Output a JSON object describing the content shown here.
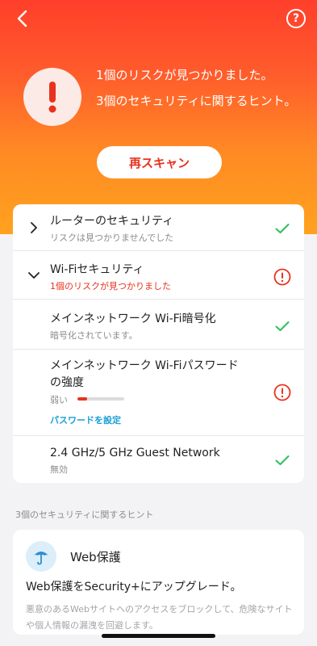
{
  "header": {
    "back_icon": "chevron-left-icon",
    "help_icon": "question-circle-icon",
    "alert_icon": "exclamation-icon",
    "message_line1": "1個のリスクが見つかりました。",
    "message_line2": "3個のセキュリティに関するヒント。",
    "rescan_label": "再スキャン"
  },
  "checks": [
    {
      "title": "ルーターのセキュリティ",
      "subtitle": "リスクは見つかりませんでした",
      "expand_icon": "chevron-right-icon",
      "status_icon": "check-icon"
    },
    {
      "title": "Wi-Fiセキュリティ",
      "subtitle": "1個のリスクが見つかりました",
      "expand_icon": "chevron-down-icon",
      "status_icon": "warning-circle-icon"
    },
    {
      "title": "メインネットワーク Wi-Fi暗号化",
      "subtitle": "暗号化されています。",
      "status_icon": "check-icon"
    },
    {
      "title_line1": "メインネットワーク Wi-Fiパスワード",
      "title_line2": "の強度",
      "subtitle": "弱い",
      "strength_fraction": 0.2,
      "link_label": "パスワードを設定",
      "status_icon": "warning-circle-icon"
    },
    {
      "title": "2.4 GHz/5 GHz Guest Network",
      "subtitle": "無効",
      "status_icon": "check-icon"
    }
  ],
  "tips": {
    "section_label": "3個のセキュリティに関するヒント",
    "card": {
      "icon": "umbrella-icon",
      "title": "Web保護",
      "heading": "Web保護をSecurity+にアップグレード。",
      "description": "悪意のあるWebサイトへのアクセスをブロックして、危険なサイトや個人情報の漏洩を回避します。"
    }
  },
  "colors": {
    "accent_red": "#e8321e",
    "check_green": "#2fbf5d",
    "link_blue": "#1aa0d6"
  }
}
